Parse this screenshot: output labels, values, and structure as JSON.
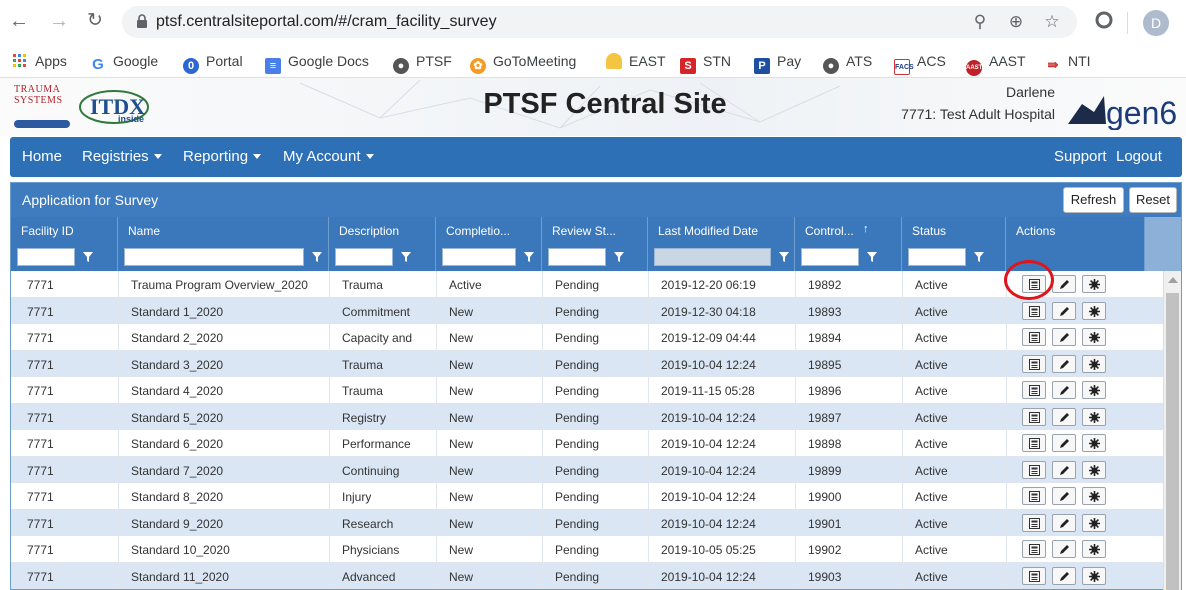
{
  "browser": {
    "url": "ptsf.centralsiteportal.com/#/cram_facility_survey",
    "profile_initial": "D",
    "bookmarks": [
      {
        "label": "Apps",
        "icon": "apps-grid-icon"
      },
      {
        "label": "Google",
        "icon": "google-icon"
      },
      {
        "label": "Portal",
        "icon": "portal-icon"
      },
      {
        "label": "Google Docs",
        "icon": "google-docs-icon"
      },
      {
        "label": "PTSF",
        "icon": "globe-icon"
      },
      {
        "label": "GoToMeeting",
        "icon": "gotomeeting-icon"
      },
      {
        "label": "EAST",
        "icon": "east-icon"
      },
      {
        "label": "STN",
        "icon": "stn-icon"
      },
      {
        "label": "Pay",
        "icon": "paypal-icon"
      },
      {
        "label": "ATS",
        "icon": "globe-icon"
      },
      {
        "label": "ACS",
        "icon": "acs-icon"
      },
      {
        "label": "AAST",
        "icon": "aast-icon"
      },
      {
        "label": "NTI",
        "icon": "nti-icon"
      }
    ]
  },
  "header": {
    "title": "PTSF Central Site",
    "user_name": "Darlene",
    "facility": "7771: Test Adult Hospital",
    "logo_left_text": "TRAUMA SYSTEMS",
    "logo_itdx_text": "ITDX",
    "logo_itdx_sub": "inside",
    "logo_right_text": "gen6"
  },
  "nav": {
    "home": "Home",
    "registries": "Registries",
    "reporting": "Reporting",
    "my_account": "My Account",
    "support": "Support",
    "logout": "Logout"
  },
  "panel": {
    "title": "Application for Survey",
    "refresh": "Refresh",
    "reset": "Reset"
  },
  "columns": [
    "Facility ID",
    "Name",
    "Description",
    "Completio...",
    "Review St...",
    "Last Modified Date",
    "Control...",
    "Status",
    "Actions"
  ],
  "rows": [
    [
      "7771",
      "Trauma Program Overview_2020",
      "Trauma",
      "Active",
      "Pending",
      "2019-12-20 06:19",
      "19892",
      "Active"
    ],
    [
      "7771",
      "Standard 1_2020",
      "Commitment",
      "New",
      "Pending",
      "2019-12-30 04:18",
      "19893",
      "Active"
    ],
    [
      "7771",
      "Standard 2_2020",
      "Capacity and",
      "New",
      "Pending",
      "2019-12-09 04:44",
      "19894",
      "Active"
    ],
    [
      "7771",
      "Standard 3_2020",
      "Trauma",
      "New",
      "Pending",
      "2019-10-04 12:24",
      "19895",
      "Active"
    ],
    [
      "7771",
      "Standard 4_2020",
      "Trauma",
      "New",
      "Pending",
      "2019-11-15 05:28",
      "19896",
      "Active"
    ],
    [
      "7771",
      "Standard 5_2020",
      "Registry",
      "New",
      "Pending",
      "2019-10-04 12:24",
      "19897",
      "Active"
    ],
    [
      "7771",
      "Standard 6_2020",
      "Performance",
      "New",
      "Pending",
      "2019-10-04 12:24",
      "19898",
      "Active"
    ],
    [
      "7771",
      "Standard 7_2020",
      "Continuing",
      "New",
      "Pending",
      "2019-10-04 12:24",
      "19899",
      "Active"
    ],
    [
      "7771",
      "Standard 8_2020",
      "Injury",
      "New",
      "Pending",
      "2019-10-04 12:24",
      "19900",
      "Active"
    ],
    [
      "7771",
      "Standard 9_2020",
      "Research",
      "New",
      "Pending",
      "2019-10-04 12:24",
      "19901",
      "Active"
    ],
    [
      "7771",
      "Standard 10_2020",
      "Physicians",
      "New",
      "Pending",
      "2019-10-05 05:25",
      "19902",
      "Active"
    ],
    [
      "7771",
      "Standard 11_2020",
      "Advanced",
      "New",
      "Pending",
      "2019-10-04 12:24",
      "19903",
      "Active"
    ]
  ],
  "colors": {
    "nav_blue": "#2d70b6",
    "panel_blue": "#3e7cbf",
    "row_alt": "#dae6f3",
    "highlight_red": "#e0141b"
  }
}
